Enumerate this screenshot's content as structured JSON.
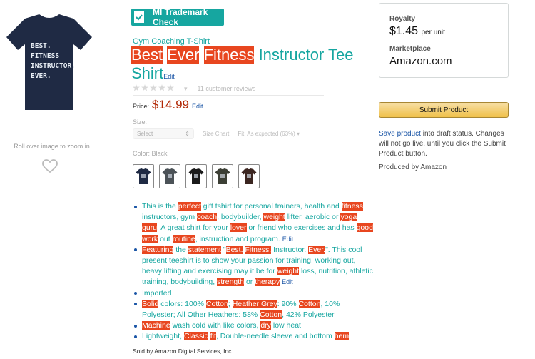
{
  "left": {
    "shirt_text_lines": [
      "BEST.",
      "FITNESS",
      "INSTRUCTOR.",
      "EVER."
    ],
    "zoom_hint": "Roll over image to zoom in"
  },
  "trademark_check": {
    "label": "MI Trademark Check"
  },
  "product": {
    "brand": "Gym Coaching T-Shirt",
    "title_parts": [
      {
        "text": "Best",
        "highlight": true
      },
      {
        "text": " ",
        "highlight": false
      },
      {
        "text": "Ever",
        "highlight": true
      },
      {
        "text": " ",
        "highlight": false
      },
      {
        "text": "Fitness",
        "highlight": true
      },
      {
        "text": " Instructor Tee Shirt",
        "highlight": false
      }
    ],
    "edit_label": "Edit",
    "ratings_text": "11 customer reviews",
    "price_label": "Price:",
    "price_value": "$14.99",
    "size_label": "Size:",
    "size_select": "Select",
    "size_chart": "Size Chart",
    "fit_text": "Fit: As expected (63%)",
    "color_label": "Color: Black",
    "swatch_colors": [
      "#1f2a44",
      "#4b5257",
      "#1a1a1a",
      "#3c3f35",
      "#3b2520"
    ],
    "bullets": [
      [
        {
          "text": "This is the ",
          "highlight": false
        },
        {
          "text": "perfect",
          "highlight": true
        },
        {
          "text": " gift tshirt for personal trainers, health and ",
          "highlight": false
        },
        {
          "text": "fitness",
          "highlight": true
        },
        {
          "text": " instructors, gym ",
          "highlight": false
        },
        {
          "text": "coach",
          "highlight": true
        },
        {
          "text": ", bodybuilder, ",
          "highlight": false
        },
        {
          "text": "weight",
          "highlight": true
        },
        {
          "text": " lifter, aerobic or ",
          "highlight": false
        },
        {
          "text": "yoga guru",
          "highlight": true
        },
        {
          "text": ". A great shirt for your ",
          "highlight": false
        },
        {
          "text": "lover",
          "highlight": true
        },
        {
          "text": " or friend who exercises and has ",
          "highlight": false
        },
        {
          "text": "good work",
          "highlight": true
        },
        {
          "text": " out ",
          "highlight": false
        },
        {
          "text": "routine",
          "highlight": true
        },
        {
          "text": ", instruction and program.",
          "highlight": false
        }
      ],
      [
        {
          "text": "Featuring",
          "highlight": true
        },
        {
          "text": " the ",
          "highlight": false
        },
        {
          "text": "statement",
          "highlight": true
        },
        {
          "text": " \"",
          "highlight": false
        },
        {
          "text": "Best.",
          "highlight": true
        },
        {
          "text": " ",
          "highlight": false
        },
        {
          "text": "Fitness.",
          "highlight": true
        },
        {
          "text": " Instructor. ",
          "highlight": false
        },
        {
          "text": "Ever.",
          "highlight": true
        },
        {
          "text": "\". This cool present teeshirt is to show your passion for training, working out, heavy lifting and exercising may it be for ",
          "highlight": false
        },
        {
          "text": "weight",
          "highlight": true
        },
        {
          "text": " loss, nutrition, athletic training, bodybuilding, ",
          "highlight": false
        },
        {
          "text": "strength",
          "highlight": true
        },
        {
          "text": " or ",
          "highlight": false
        },
        {
          "text": "therapy",
          "highlight": true
        }
      ],
      [
        {
          "text": "Imported",
          "highlight": false
        }
      ],
      [
        {
          "text": "Solid",
          "highlight": true
        },
        {
          "text": " colors: 100% ",
          "highlight": false
        },
        {
          "text": "Cotton",
          "highlight": true
        },
        {
          "text": "; ",
          "highlight": false
        },
        {
          "text": "Heather Grey",
          "highlight": true
        },
        {
          "text": ": 90% ",
          "highlight": false
        },
        {
          "text": "Cotton",
          "highlight": true
        },
        {
          "text": ", 10% Polyester; All Other Heathers: 58% ",
          "highlight": false
        },
        {
          "text": "Cotton",
          "highlight": true
        },
        {
          "text": ", 42% Polyester",
          "highlight": false
        }
      ],
      [
        {
          "text": "Machine",
          "highlight": true
        },
        {
          "text": " wash cold with like colors, ",
          "highlight": false
        },
        {
          "text": "dry",
          "highlight": true
        },
        {
          "text": " low heat",
          "highlight": false
        }
      ],
      [
        {
          "text": "Lightweight, ",
          "highlight": false
        },
        {
          "text": "Classic",
          "highlight": true
        },
        {
          "text": " ",
          "highlight": false
        },
        {
          "text": "fit",
          "highlight": true
        },
        {
          "text": ", Double-needle sleeve and bottom ",
          "highlight": false
        },
        {
          "text": "hem",
          "highlight": true
        }
      ]
    ],
    "bullet_edit_indices": [
      0,
      1
    ],
    "sold_by": "Sold by Amazon Digital Services, Inc."
  },
  "side_panel": {
    "royalty_label": "Royalty",
    "royalty_value": "$1.45",
    "royalty_unit": "per unit",
    "marketplace_label": "Marketplace",
    "marketplace_value": "Amazon.com",
    "submit_label": "Submit Product",
    "save_link": "Save product",
    "save_note": " into draft status. Changes will not go live, until you click the Submit Product button.",
    "produced_by": "Produced by Amazon"
  },
  "colors": {
    "accent": "#16a6a0",
    "highlight": "#e8461f",
    "price": "#b12704",
    "link": "#1a55a6",
    "shirt": "#1f2a44"
  }
}
